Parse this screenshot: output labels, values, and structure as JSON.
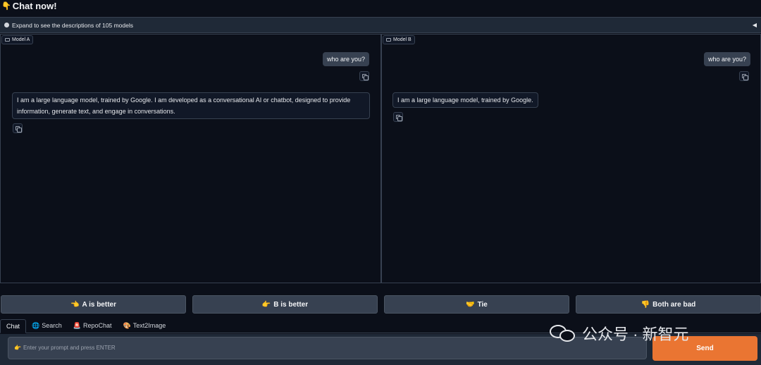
{
  "header": {
    "icon": "pointing-down-emoji",
    "title": "Chat now!"
  },
  "accordion": {
    "label": "Expand to see the descriptions of 105 models",
    "arrow": "◀"
  },
  "panels": {
    "a": {
      "tag": "Model A",
      "user_message": "who are you?",
      "bot_message": "I am a large language model, trained by Google. I am developed as a conversational AI or chatbot, designed to provide information, generate text, and engage in conversations."
    },
    "b": {
      "tag": "Model B",
      "user_message": "who are you?",
      "bot_message": "I am a large language model, trained by Google."
    }
  },
  "votes": {
    "a_better": {
      "icon": "👈",
      "label": "A is better"
    },
    "b_better": {
      "icon": "👉",
      "label": "B is better"
    },
    "tie": {
      "icon": "🤝",
      "label": "Tie"
    },
    "both_bad": {
      "icon": "👎",
      "label": "Both are bad"
    }
  },
  "tabs": [
    {
      "label": "Chat",
      "icon": ""
    },
    {
      "label": "Search",
      "icon": "🌐"
    },
    {
      "label": "RepoChat",
      "icon": "🚨"
    },
    {
      "label": "Text2Image",
      "icon": "🎨"
    }
  ],
  "input": {
    "icon": "👉",
    "placeholder": "Enter your prompt and press ENTER"
  },
  "send_label": "Send",
  "watermark": "公众号 · 新智元",
  "colors": {
    "background": "#0b0f19",
    "send_button": "#ea7532",
    "panel_border": "#374151"
  }
}
